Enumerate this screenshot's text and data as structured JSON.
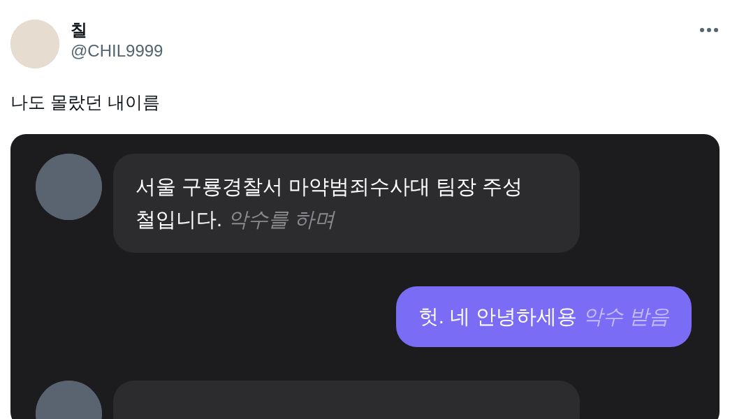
{
  "author": {
    "name": "칠",
    "handle": "@CHIL9999"
  },
  "tweet_text": "나도 몰랐던 내이름",
  "chat": {
    "messages": [
      {
        "kind": "received",
        "text": "서울 구룡경찰서 마약범죄수사대 팀장 주성철입니다.",
        "action": "악수를 하며"
      },
      {
        "kind": "sent",
        "text": "헛. 네 안녕하세용",
        "action": "악수 받음"
      },
      {
        "kind": "received"
      }
    ]
  }
}
